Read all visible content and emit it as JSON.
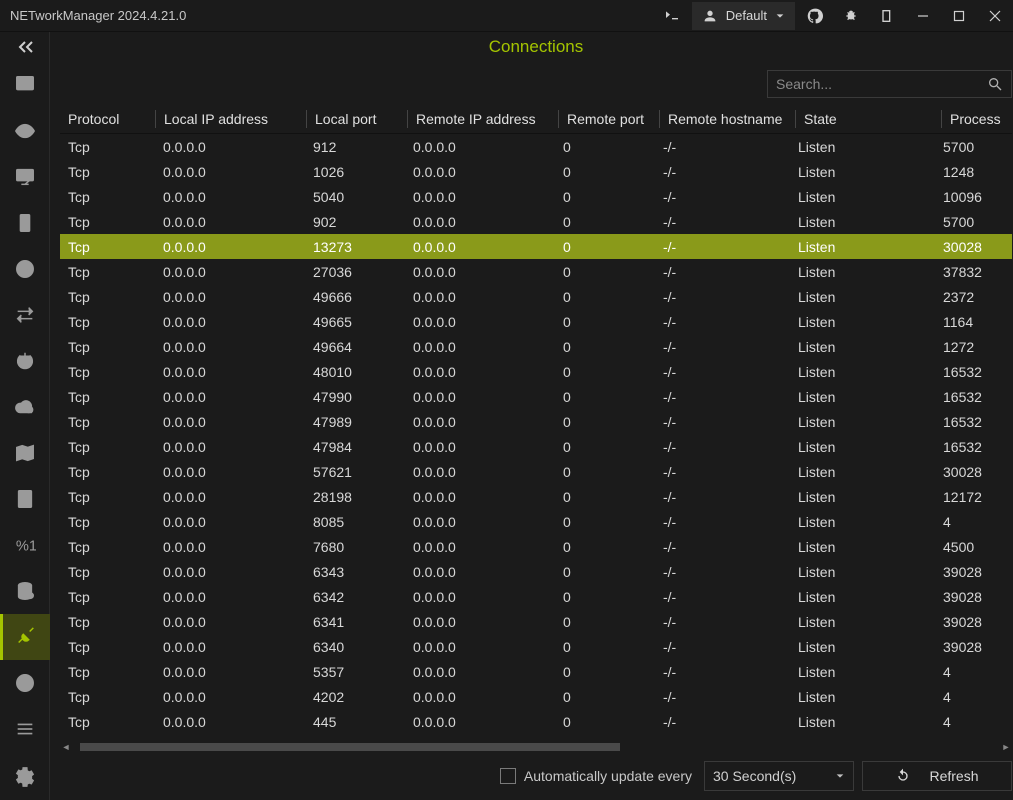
{
  "app": {
    "title": "NETworkManager 2024.4.21.0",
    "profile": "Default"
  },
  "page": {
    "title": "Connections"
  },
  "search": {
    "placeholder": "Search..."
  },
  "sidebar_icons": [
    "analyze",
    "eye",
    "monitor",
    "server",
    "history",
    "swap",
    "power",
    "cloud",
    "map",
    "calc",
    "percent",
    "db",
    "plug",
    "globe",
    "menu2"
  ],
  "table": {
    "headers": [
      "Protocol",
      "Local IP address",
      "Local port",
      "Remote IP address",
      "Remote port",
      "Remote hostname",
      "State",
      "Process"
    ],
    "rows": [
      {
        "sel": false,
        "v": [
          "Tcp",
          "0.0.0.0",
          "912",
          "0.0.0.0",
          "0",
          "-/-",
          "Listen",
          "5700"
        ]
      },
      {
        "sel": false,
        "v": [
          "Tcp",
          "0.0.0.0",
          "1026",
          "0.0.0.0",
          "0",
          "-/-",
          "Listen",
          "1248"
        ]
      },
      {
        "sel": false,
        "v": [
          "Tcp",
          "0.0.0.0",
          "5040",
          "0.0.0.0",
          "0",
          "-/-",
          "Listen",
          "10096"
        ]
      },
      {
        "sel": false,
        "v": [
          "Tcp",
          "0.0.0.0",
          "902",
          "0.0.0.0",
          "0",
          "-/-",
          "Listen",
          "5700"
        ]
      },
      {
        "sel": true,
        "v": [
          "Tcp",
          "0.0.0.0",
          "13273",
          "0.0.0.0",
          "0",
          "-/-",
          "Listen",
          "30028"
        ]
      },
      {
        "sel": false,
        "v": [
          "Tcp",
          "0.0.0.0",
          "27036",
          "0.0.0.0",
          "0",
          "-/-",
          "Listen",
          "37832"
        ]
      },
      {
        "sel": false,
        "v": [
          "Tcp",
          "0.0.0.0",
          "49666",
          "0.0.0.0",
          "0",
          "-/-",
          "Listen",
          "2372"
        ]
      },
      {
        "sel": false,
        "v": [
          "Tcp",
          "0.0.0.0",
          "49665",
          "0.0.0.0",
          "0",
          "-/-",
          "Listen",
          "1164"
        ]
      },
      {
        "sel": false,
        "v": [
          "Tcp",
          "0.0.0.0",
          "49664",
          "0.0.0.0",
          "0",
          "-/-",
          "Listen",
          "1272"
        ]
      },
      {
        "sel": false,
        "v": [
          "Tcp",
          "0.0.0.0",
          "48010",
          "0.0.0.0",
          "0",
          "-/-",
          "Listen",
          "16532"
        ]
      },
      {
        "sel": false,
        "v": [
          "Tcp",
          "0.0.0.0",
          "47990",
          "0.0.0.0",
          "0",
          "-/-",
          "Listen",
          "16532"
        ]
      },
      {
        "sel": false,
        "v": [
          "Tcp",
          "0.0.0.0",
          "47989",
          "0.0.0.0",
          "0",
          "-/-",
          "Listen",
          "16532"
        ]
      },
      {
        "sel": false,
        "v": [
          "Tcp",
          "0.0.0.0",
          "47984",
          "0.0.0.0",
          "0",
          "-/-",
          "Listen",
          "16532"
        ]
      },
      {
        "sel": false,
        "v": [
          "Tcp",
          "0.0.0.0",
          "57621",
          "0.0.0.0",
          "0",
          "-/-",
          "Listen",
          "30028"
        ]
      },
      {
        "sel": false,
        "v": [
          "Tcp",
          "0.0.0.0",
          "28198",
          "0.0.0.0",
          "0",
          "-/-",
          "Listen",
          "12172"
        ]
      },
      {
        "sel": false,
        "v": [
          "Tcp",
          "0.0.0.0",
          "8085",
          "0.0.0.0",
          "0",
          "-/-",
          "Listen",
          "4"
        ]
      },
      {
        "sel": false,
        "v": [
          "Tcp",
          "0.0.0.0",
          "7680",
          "0.0.0.0",
          "0",
          "-/-",
          "Listen",
          "4500"
        ]
      },
      {
        "sel": false,
        "v": [
          "Tcp",
          "0.0.0.0",
          "6343",
          "0.0.0.0",
          "0",
          "-/-",
          "Listen",
          "39028"
        ]
      },
      {
        "sel": false,
        "v": [
          "Tcp",
          "0.0.0.0",
          "6342",
          "0.0.0.0",
          "0",
          "-/-",
          "Listen",
          "39028"
        ]
      },
      {
        "sel": false,
        "v": [
          "Tcp",
          "0.0.0.0",
          "6341",
          "0.0.0.0",
          "0",
          "-/-",
          "Listen",
          "39028"
        ]
      },
      {
        "sel": false,
        "v": [
          "Tcp",
          "0.0.0.0",
          "6340",
          "0.0.0.0",
          "0",
          "-/-",
          "Listen",
          "39028"
        ]
      },
      {
        "sel": false,
        "v": [
          "Tcp",
          "0.0.0.0",
          "5357",
          "0.0.0.0",
          "0",
          "-/-",
          "Listen",
          "4"
        ]
      },
      {
        "sel": false,
        "v": [
          "Tcp",
          "0.0.0.0",
          "4202",
          "0.0.0.0",
          "0",
          "-/-",
          "Listen",
          "4"
        ]
      },
      {
        "sel": false,
        "v": [
          "Tcp",
          "0.0.0.0",
          "445",
          "0.0.0.0",
          "0",
          "-/-",
          "Listen",
          "4"
        ]
      }
    ]
  },
  "footer": {
    "checkbox_label": "Automatically update every",
    "interval": "30 Second(s)",
    "refresh": "Refresh"
  }
}
